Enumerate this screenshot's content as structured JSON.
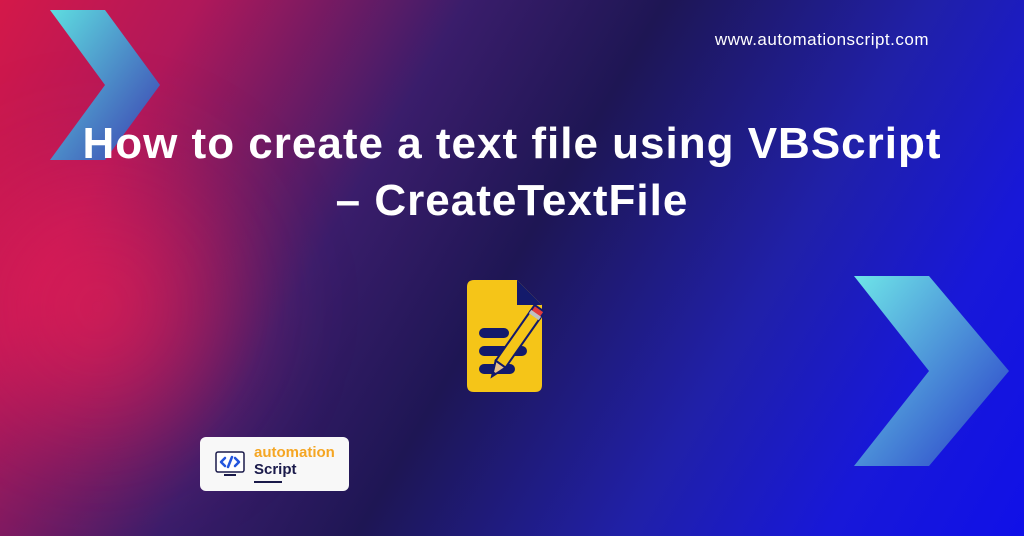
{
  "url": "www.automationscript.com",
  "title": "How to create a text file using VBScript – CreateTextFile",
  "logo": {
    "line1": "automation",
    "line2": "Script"
  },
  "colors": {
    "document_fill": "#f5c518",
    "document_lines": "#131a6b",
    "pencil_body": "#f5c518",
    "pencil_eraser": "#e43b3b",
    "chevron_start": "#5edde0",
    "chevron_end": "#3040b8"
  }
}
